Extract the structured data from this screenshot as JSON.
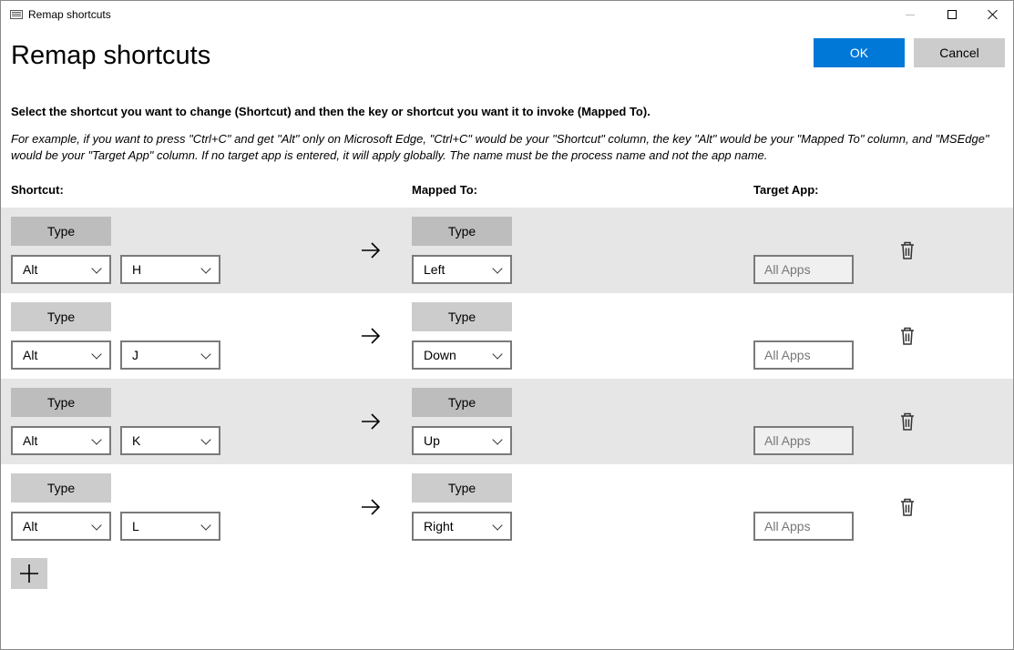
{
  "window": {
    "title": "Remap shortcuts"
  },
  "header": {
    "title": "Remap shortcuts",
    "ok_label": "OK",
    "cancel_label": "Cancel",
    "accent_color": "#0078d7"
  },
  "instructions": {
    "main": "Select the shortcut you want to change (Shortcut) and then the key or shortcut you want it to invoke (Mapped To).",
    "example": "For example, if you want to press \"Ctrl+C\" and get \"Alt\" only on Microsoft Edge, \"Ctrl+C\" would be your \"Shortcut\" column, the key \"Alt\" would be your \"Mapped To\" column, and \"MSEdge\" would be your \"Target App\" column. If no target app is entered, it will apply globally. The name must be the process name and not the app name."
  },
  "columns": {
    "shortcut": "Shortcut:",
    "mapped_to": "Mapped To:",
    "target_app": "Target App:"
  },
  "rows": [
    {
      "type_label": "Type",
      "modifier": "Alt",
      "key": "H",
      "mapped_type_label": "Type",
      "mapped": "Left",
      "target_placeholder": "All Apps"
    },
    {
      "type_label": "Type",
      "modifier": "Alt",
      "key": "J",
      "mapped_type_label": "Type",
      "mapped": "Down",
      "target_placeholder": "All Apps"
    },
    {
      "type_label": "Type",
      "modifier": "Alt",
      "key": "K",
      "mapped_type_label": "Type",
      "mapped": "Up",
      "target_placeholder": "All Apps"
    },
    {
      "type_label": "Type",
      "modifier": "Alt",
      "key": "L",
      "mapped_type_label": "Type",
      "mapped": "Right",
      "target_placeholder": "All Apps"
    }
  ],
  "icons": {
    "arrow": "arrow-right-icon",
    "delete": "trash-icon",
    "add": "plus-icon"
  }
}
